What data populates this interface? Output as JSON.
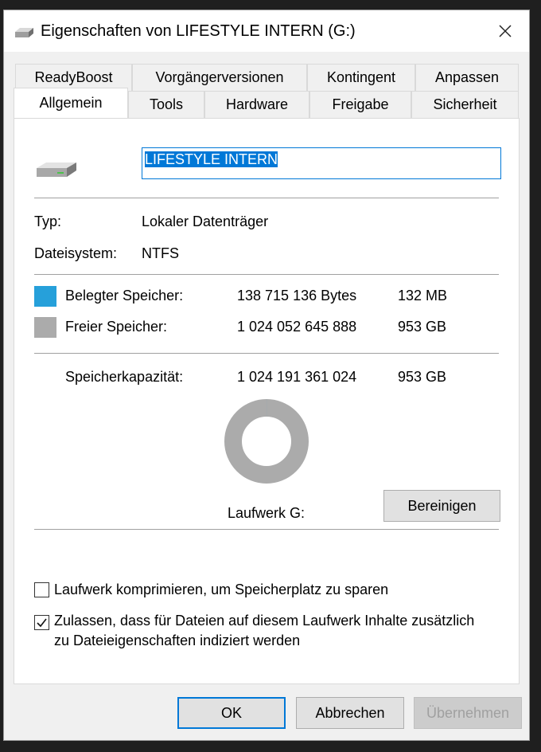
{
  "window": {
    "title": "Eigenschaften von LIFESTYLE INTERN (G:)"
  },
  "tabs_row1": [
    "ReadyBoost",
    "Vorgängerversionen",
    "Kontingent",
    "Anpassen"
  ],
  "tabs_row2": [
    "Allgemein",
    "Tools",
    "Hardware",
    "Freigabe",
    "Sicherheit"
  ],
  "active_tab": "Allgemein",
  "drive": {
    "name_value": "LIFESTYLE INTERN",
    "icon": "drive-icon"
  },
  "info": {
    "type_label": "Typ:",
    "type_value": "Lokaler Datenträger",
    "fs_label": "Dateisystem:",
    "fs_value": "NTFS"
  },
  "usage": {
    "used_label": "Belegter Speicher:",
    "used_bytes": "138 715 136 Bytes",
    "used_size": "132 MB",
    "free_label": "Freier Speicher:",
    "free_bytes": "1 024 052 645 888",
    "free_size": "953 GB",
    "capacity_label": "Speicherkapazität:",
    "capacity_bytes": "1 024 191 361 024",
    "capacity_size": "953 GB",
    "used_color": "#26a0da",
    "free_color": "#ababab",
    "used_fraction": 0.000135
  },
  "drive_label": "Laufwerk G:",
  "cleanup_button": "Bereinigen",
  "options": {
    "compress_label": "Laufwerk komprimieren, um Speicherplatz zu sparen",
    "compress_checked": false,
    "index_label_line1": "Zulassen, dass für Dateien auf diesem Laufwerk Inhalte zusätzlich",
    "index_label_line2": "zu Dateieigenschaften indiziert werden",
    "index_checked": true
  },
  "footer": {
    "ok": "OK",
    "cancel": "Abbrechen",
    "apply": "Übernehmen"
  }
}
